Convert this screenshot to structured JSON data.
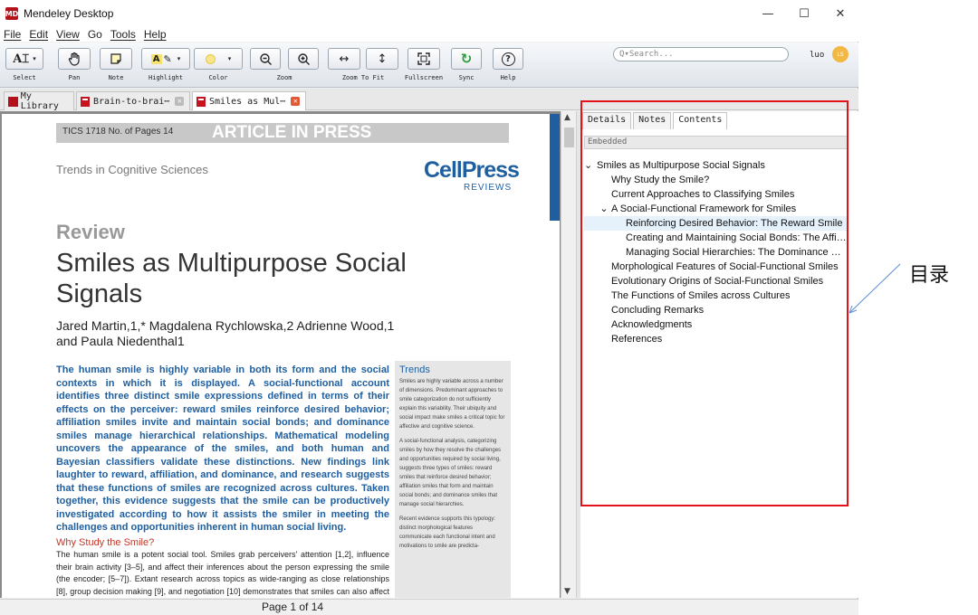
{
  "window": {
    "title": "Mendeley Desktop",
    "logo": "MD",
    "min": "—",
    "max": "☐",
    "close": "✕"
  },
  "menu": [
    "File",
    "Edit",
    "View",
    "Go",
    "Tools",
    "Help"
  ],
  "toolbar": {
    "items": [
      {
        "label": "Select",
        "icon": "cursor-icon"
      },
      {
        "label": "Pan",
        "icon": "hand-icon"
      },
      {
        "label": "Note",
        "icon": "note-icon"
      },
      {
        "label": "Highlight",
        "icon": "highlight-icon"
      },
      {
        "label": "Color",
        "icon": "color-swatch-icon"
      },
      {
        "label": "Zoom",
        "icon": "zoom-icon"
      },
      {
        "label": "Zoom To Fit",
        "icon": "fit-icon"
      },
      {
        "label": "Fullscreen",
        "icon": "fullscreen-icon"
      },
      {
        "label": "Sync",
        "icon": "sync-icon"
      },
      {
        "label": "Help",
        "icon": "help-icon"
      }
    ],
    "search_placeholder": "Q▾Search...",
    "username": "luo",
    "avatar_text": "LS"
  },
  "tabs": [
    {
      "label": "My Library"
    },
    {
      "label": "Brain-to-brai⋯"
    },
    {
      "label": "Smiles as Mul⋯"
    }
  ],
  "document": {
    "header_left": "TICS 1718  No. of Pages 14",
    "header_right": "ARTICLE IN PRESS",
    "journal": "Trends in Cognitive Sciences",
    "publisher": "CellPress",
    "publisher_sub": "REVIEWS",
    "section": "Review",
    "title": "Smiles as Multipurpose Social Signals",
    "authors": "Jared Martin,1,* Magdalena Rychlowska,2 Adrienne Wood,1 and Paula Niedenthal1",
    "abstract": "The human smile is highly variable in both its form and the social contexts in which it is displayed. A social-functional account identifies three distinct smile expressions defined in terms of their effects on the perceiver: reward smiles reinforce desired behavior; affiliation smiles invite and maintain social bonds; and dominance smiles manage hierarchical relationships. Mathematical modeling uncovers the appearance of the smiles, and both human and Bayesian classifiers validate these distinctions. New findings link laughter to reward, affiliation, and dominance, and research suggests that these functions of smiles are recognized across cultures. Taken together, this evidence suggests that the smile can be productively investigated according to how it assists the smiler in meeting the challenges and opportunities inherent in human social living.",
    "section_heading": "Why Study the Smile?",
    "body": "The human smile is a potent social tool. Smiles grab perceivers' attention [1,2], influence their brain activity [3–5], and affect their inferences about the person expressing the smile (the encoder; [5–7]). Extant research across topics as wide-ranging as close relationships [8], group decision making [9], and negotiation [10] demonstrates that smiles can also affect the behavior",
    "trends_title": "Trends",
    "trends": [
      "Smiles are highly variable across a number of dimensions. Predominant approaches to smile categorization do not sufficiently explain this variability. Their ubiquity and social impact make smiles a critical topic for affective and cognitive science.",
      "A social-functional analysis, categorizing smiles by how they resolve the challenges and opportunities required by social living, suggests three types of smiles: reward smiles that reinforce desired behavior; affiliation smiles that form and maintain social bonds; and dominance smiles that manage social hierarchies.",
      "Recent evidence supports this typology: distinct morphological features communicate each functional intent and motivations to smile are predicta-"
    ]
  },
  "status": {
    "page_info": "Page 1 of 14"
  },
  "side_panel": {
    "tabs": [
      "Details",
      "Notes",
      "Contents"
    ],
    "source": "Embedded",
    "toc": [
      {
        "label": "Smiles as Multipurpose Social Signals",
        "level": 0,
        "toggle": "⌄"
      },
      {
        "label": "Why Study the Smile?",
        "level": 1
      },
      {
        "label": "Current Approaches to Classifying Smiles",
        "level": 1
      },
      {
        "label": "A Social-Functional Framework for Smiles",
        "level": 1,
        "toggle": "⌄"
      },
      {
        "label": "Reinforcing Desired Behavior: The Reward Smile",
        "level": 2,
        "selected": true
      },
      {
        "label": "Creating and Maintaining Social Bonds: The Affiliati...",
        "level": 2
      },
      {
        "label": "Managing Social Hierarchies: The Dominance Smile",
        "level": 2
      },
      {
        "label": "Morphological Features of Social-Functional Smiles",
        "level": 1
      },
      {
        "label": "Evolutionary Origins of Social-Functional Smiles",
        "level": 1
      },
      {
        "label": "The Functions of Smiles across Cultures",
        "level": 1
      },
      {
        "label": "Concluding Remarks",
        "level": 1
      },
      {
        "label": "Acknowledgments",
        "level": 1
      },
      {
        "label": "References",
        "level": 1
      }
    ]
  },
  "annotation": {
    "label": "目录",
    "color": "#e3121b"
  }
}
